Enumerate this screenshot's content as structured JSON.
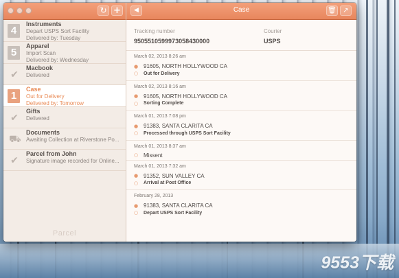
{
  "sidebar": {
    "toolbar": {
      "refresh_icon": "refresh-icon",
      "add_icon": "plus-icon"
    },
    "items": [
      {
        "badge": "4",
        "name": "Instruments",
        "line1": "Depart USPS Sort Facility",
        "line2": "Delivered by: Tuesday",
        "icon": ""
      },
      {
        "badge": "5",
        "name": "Apparel",
        "line1": "Import Scan",
        "line2": "Delivered by: Wednesday",
        "icon": ""
      },
      {
        "badge": "",
        "name": "Macbook",
        "line1": "Delivered",
        "line2": "",
        "icon": "check-icon"
      },
      {
        "badge": "1",
        "name": "Case",
        "line1": "Out for Delivery",
        "line2": "Delivered by: Tomorrow",
        "icon": ""
      },
      {
        "badge": "",
        "name": "Gifts",
        "line1": "Delivered",
        "line2": "",
        "icon": "check-icon"
      },
      {
        "badge": "",
        "name": "Documents",
        "line1": "Awaiting Collection at Riverstone Po...",
        "line2": "",
        "icon": "truck-icon"
      },
      {
        "badge": "",
        "name": "Parcel from John",
        "line1": "Signature image recorded for Online...",
        "line2": "",
        "icon": "check-icon"
      }
    ],
    "footer": "Parcel"
  },
  "detail": {
    "title": "Case",
    "tracking_label": "Tracking number",
    "tracking_value": "9505510599973058430000",
    "courier_label": "Courier",
    "courier_value": "USPS",
    "events": [
      {
        "date": "March 02, 2013 8:26 am",
        "location": "91605, NORTH HOLLYWOOD CA",
        "status": "Out for Delivery"
      },
      {
        "date": "March 02, 2013 8:16 am",
        "location": "91605, NORTH HOLLYWOOD CA",
        "status": "Sorting Complete"
      },
      {
        "date": "March 01, 2013 7:08 pm",
        "location": "91383, SANTA CLARITA CA",
        "status": "Processed through USPS Sort Facility"
      },
      {
        "date": "March 01, 2013 8:37 am",
        "location": "",
        "status": "Missent"
      },
      {
        "date": "March 01, 2013 7:32 am",
        "location": "91352, SUN VALLEY CA",
        "status": "Arrival at Post Office"
      },
      {
        "date": "February 28, 2013",
        "location": "91383, SANTA CLARITA CA",
        "status": "Depart USPS Sort Facility"
      }
    ]
  },
  "watermark": "9553下载"
}
